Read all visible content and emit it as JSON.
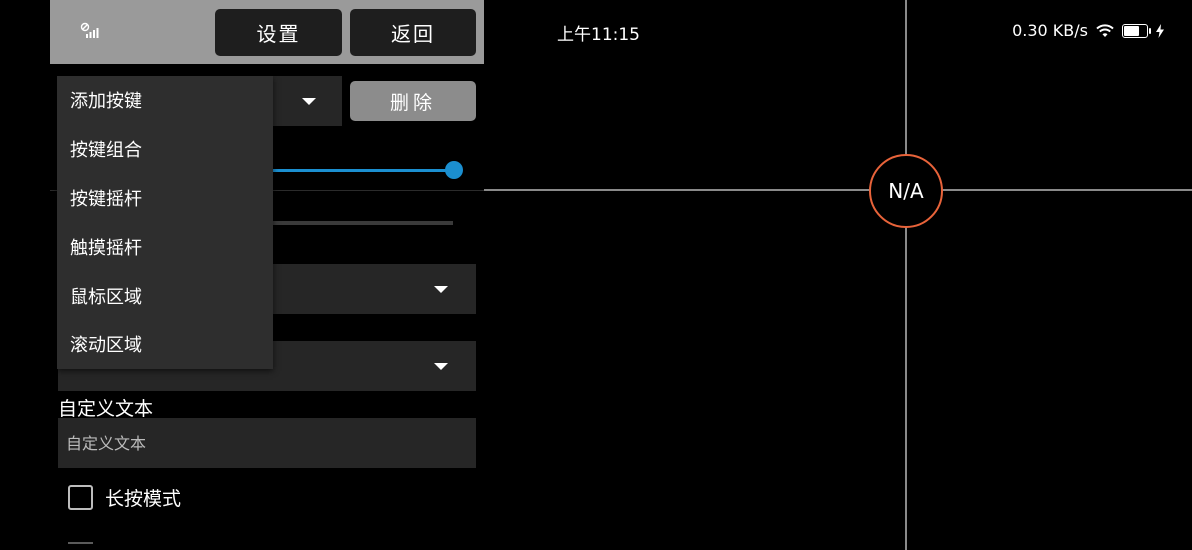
{
  "status_bar": {
    "time": "上午11:15",
    "net_speed": "0.30 KB/s"
  },
  "header": {
    "settings_label": "设置",
    "back_label": "返回"
  },
  "controls": {
    "delete_label": "删除",
    "slider_value_fraction": 1.0
  },
  "menu": {
    "items": [
      "添加按键",
      "按键组合",
      "按键摇杆",
      "触摸摇杆",
      "鼠标区域",
      "滚动区域"
    ]
  },
  "custom_text": {
    "label": "自定义文本",
    "placeholder": "自定义文本"
  },
  "long_press": {
    "label": "长按模式",
    "checked": false
  },
  "canvas": {
    "center_label": "N/A",
    "accent_color": "#e8633a",
    "slider_color": "#1b8fd0"
  }
}
